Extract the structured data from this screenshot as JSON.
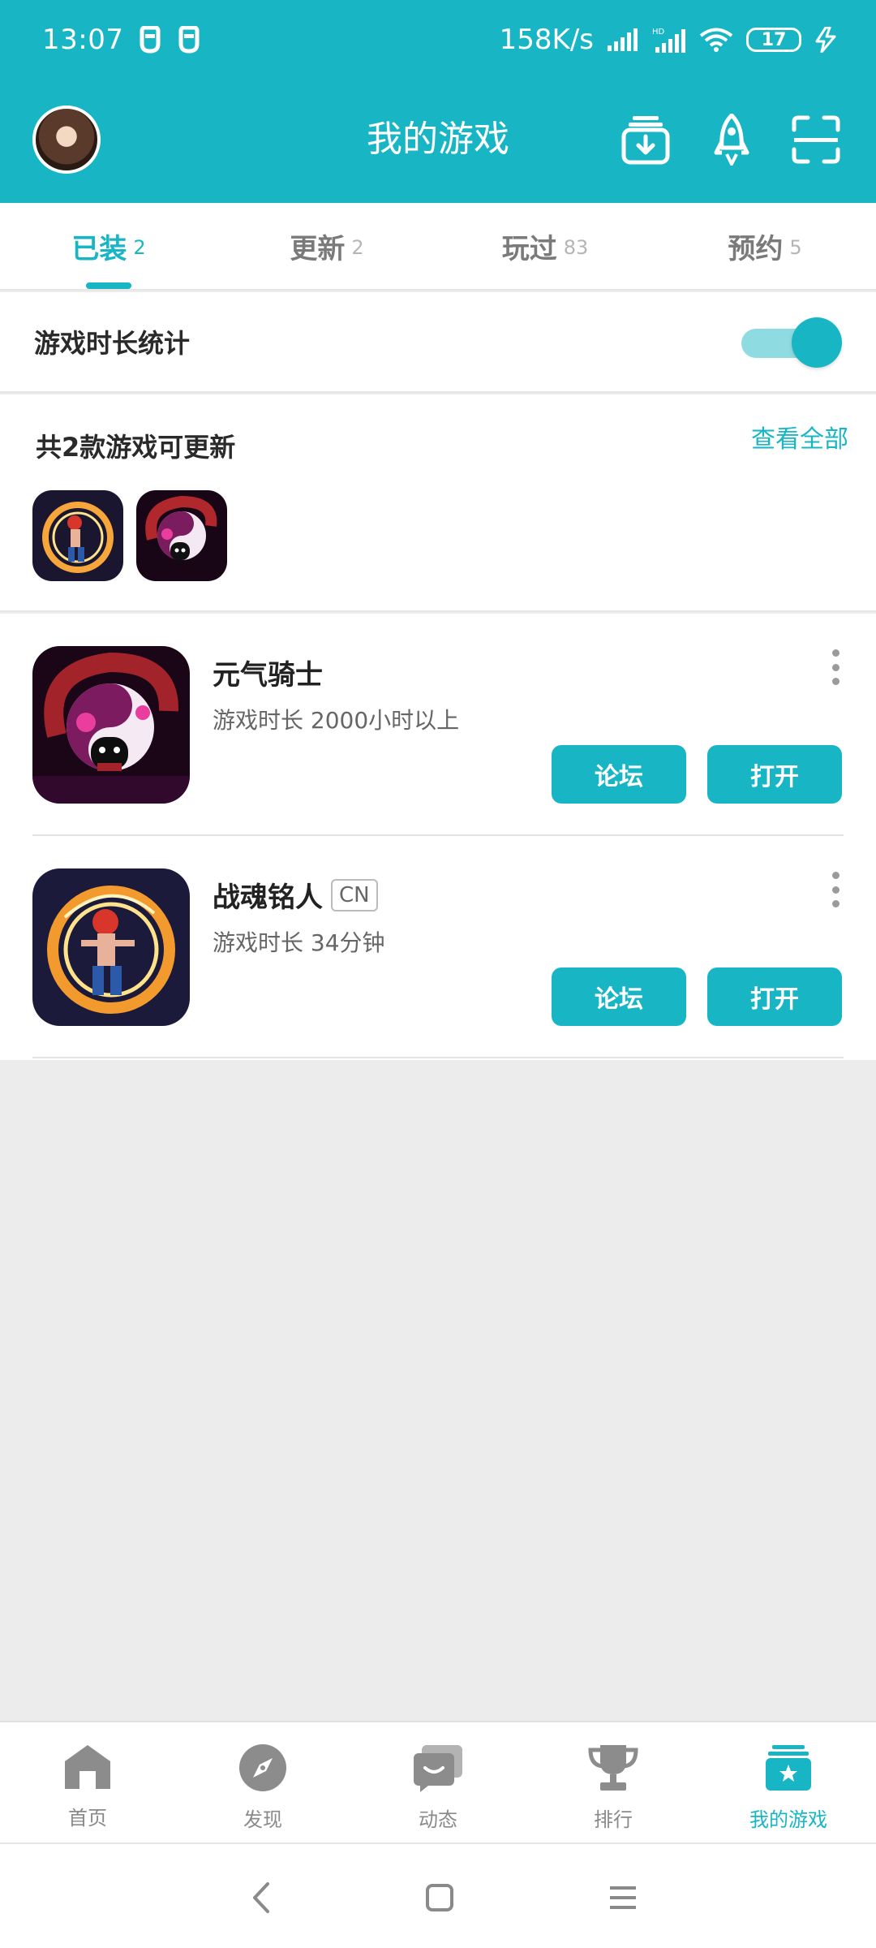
{
  "colors": {
    "accent": "#18b6c5",
    "background": "#ececec"
  },
  "status_bar": {
    "time": "13:07",
    "net_speed": "158K/s",
    "battery": "17",
    "icons": [
      "notification-icon",
      "notification-icon",
      "signal-icon",
      "hd-signal-icon",
      "wifi-icon",
      "battery-icon",
      "charging-icon"
    ]
  },
  "header": {
    "title": "我的游戏",
    "icons": [
      "avatar",
      "download-icon",
      "rocket-icon",
      "scan-icon"
    ]
  },
  "tabs": [
    {
      "label": "已装",
      "count": "2",
      "active": true
    },
    {
      "label": "更新",
      "count": "2",
      "active": false
    },
    {
      "label": "玩过",
      "count": "83",
      "active": false
    },
    {
      "label": "预约",
      "count": "5",
      "active": false
    }
  ],
  "playtime_stats": {
    "label": "游戏时长统计",
    "enabled": true
  },
  "updates": {
    "title": "共2款游戏可更新",
    "view_all": "查看全部"
  },
  "games": [
    {
      "name": "元气骑士",
      "tag": "",
      "playtime": "游戏时长 2000小时以上",
      "forum_label": "论坛",
      "open_label": "打开"
    },
    {
      "name": "战魂铭人",
      "tag": "CN",
      "playtime": "游戏时长 34分钟",
      "forum_label": "论坛",
      "open_label": "打开"
    }
  ],
  "bottom_nav": [
    {
      "label": "首页",
      "icon": "home-icon",
      "active": false
    },
    {
      "label": "发现",
      "icon": "compass-icon",
      "active": false
    },
    {
      "label": "动态",
      "icon": "chat-icon",
      "active": false
    },
    {
      "label": "排行",
      "icon": "trophy-icon",
      "active": false
    },
    {
      "label": "我的游戏",
      "icon": "my-games-icon",
      "active": true
    }
  ]
}
